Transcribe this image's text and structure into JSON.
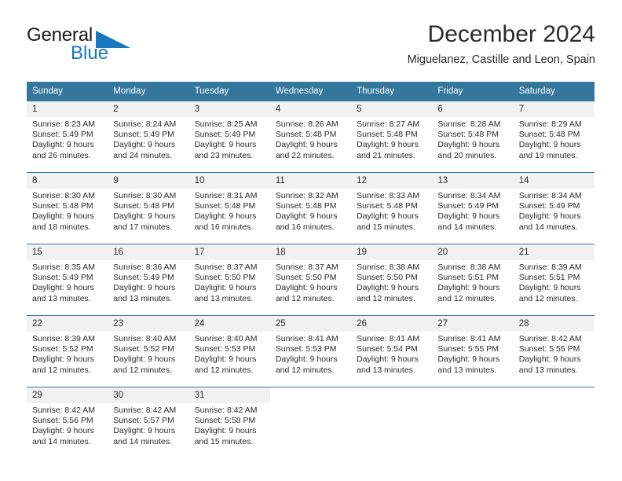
{
  "logo": {
    "primary_text": "General",
    "secondary_text": "Blue",
    "triangle_icon": "blue-triangle-icon",
    "primary_color": "#1a1a1a",
    "secondary_color": "#1878be"
  },
  "header": {
    "title": "December 2024",
    "subtitle": "Miguelanez, Castille and Leon, Spain"
  },
  "theme": {
    "header_blue": "#34769c",
    "daynum_bg": "#f1f1f1",
    "text_color": "#2b2b2b"
  },
  "weekday_headers": [
    "Sunday",
    "Monday",
    "Tuesday",
    "Wednesday",
    "Thursday",
    "Friday",
    "Saturday"
  ],
  "weeks": [
    [
      {
        "day": "1",
        "sunrise": "Sunrise: 8:23 AM",
        "sunset": "Sunset: 5:49 PM",
        "daylight_1": "Daylight: 9 hours",
        "daylight_2": "and 26 minutes."
      },
      {
        "day": "2",
        "sunrise": "Sunrise: 8:24 AM",
        "sunset": "Sunset: 5:49 PM",
        "daylight_1": "Daylight: 9 hours",
        "daylight_2": "and 24 minutes."
      },
      {
        "day": "3",
        "sunrise": "Sunrise: 8:25 AM",
        "sunset": "Sunset: 5:49 PM",
        "daylight_1": "Daylight: 9 hours",
        "daylight_2": "and 23 minutes."
      },
      {
        "day": "4",
        "sunrise": "Sunrise: 8:26 AM",
        "sunset": "Sunset: 5:48 PM",
        "daylight_1": "Daylight: 9 hours",
        "daylight_2": "and 22 minutes."
      },
      {
        "day": "5",
        "sunrise": "Sunrise: 8:27 AM",
        "sunset": "Sunset: 5:48 PM",
        "daylight_1": "Daylight: 9 hours",
        "daylight_2": "and 21 minutes."
      },
      {
        "day": "6",
        "sunrise": "Sunrise: 8:28 AM",
        "sunset": "Sunset: 5:48 PM",
        "daylight_1": "Daylight: 9 hours",
        "daylight_2": "and 20 minutes."
      },
      {
        "day": "7",
        "sunrise": "Sunrise: 8:29 AM",
        "sunset": "Sunset: 5:48 PM",
        "daylight_1": "Daylight: 9 hours",
        "daylight_2": "and 19 minutes."
      }
    ],
    [
      {
        "day": "8",
        "sunrise": "Sunrise: 8:30 AM",
        "sunset": "Sunset: 5:48 PM",
        "daylight_1": "Daylight: 9 hours",
        "daylight_2": "and 18 minutes."
      },
      {
        "day": "9",
        "sunrise": "Sunrise: 8:30 AM",
        "sunset": "Sunset: 5:48 PM",
        "daylight_1": "Daylight: 9 hours",
        "daylight_2": "and 17 minutes."
      },
      {
        "day": "10",
        "sunrise": "Sunrise: 8:31 AM",
        "sunset": "Sunset: 5:48 PM",
        "daylight_1": "Daylight: 9 hours",
        "daylight_2": "and 16 minutes."
      },
      {
        "day": "11",
        "sunrise": "Sunrise: 8:32 AM",
        "sunset": "Sunset: 5:48 PM",
        "daylight_1": "Daylight: 9 hours",
        "daylight_2": "and 16 minutes."
      },
      {
        "day": "12",
        "sunrise": "Sunrise: 8:33 AM",
        "sunset": "Sunset: 5:48 PM",
        "daylight_1": "Daylight: 9 hours",
        "daylight_2": "and 15 minutes."
      },
      {
        "day": "13",
        "sunrise": "Sunrise: 8:34 AM",
        "sunset": "Sunset: 5:49 PM",
        "daylight_1": "Daylight: 9 hours",
        "daylight_2": "and 14 minutes."
      },
      {
        "day": "14",
        "sunrise": "Sunrise: 8:34 AM",
        "sunset": "Sunset: 5:49 PM",
        "daylight_1": "Daylight: 9 hours",
        "daylight_2": "and 14 minutes."
      }
    ],
    [
      {
        "day": "15",
        "sunrise": "Sunrise: 8:35 AM",
        "sunset": "Sunset: 5:49 PM",
        "daylight_1": "Daylight: 9 hours",
        "daylight_2": "and 13 minutes."
      },
      {
        "day": "16",
        "sunrise": "Sunrise: 8:36 AM",
        "sunset": "Sunset: 5:49 PM",
        "daylight_1": "Daylight: 9 hours",
        "daylight_2": "and 13 minutes."
      },
      {
        "day": "17",
        "sunrise": "Sunrise: 8:37 AM",
        "sunset": "Sunset: 5:50 PM",
        "daylight_1": "Daylight: 9 hours",
        "daylight_2": "and 13 minutes."
      },
      {
        "day": "18",
        "sunrise": "Sunrise: 8:37 AM",
        "sunset": "Sunset: 5:50 PM",
        "daylight_1": "Daylight: 9 hours",
        "daylight_2": "and 12 minutes."
      },
      {
        "day": "19",
        "sunrise": "Sunrise: 8:38 AM",
        "sunset": "Sunset: 5:50 PM",
        "daylight_1": "Daylight: 9 hours",
        "daylight_2": "and 12 minutes."
      },
      {
        "day": "20",
        "sunrise": "Sunrise: 8:38 AM",
        "sunset": "Sunset: 5:51 PM",
        "daylight_1": "Daylight: 9 hours",
        "daylight_2": "and 12 minutes."
      },
      {
        "day": "21",
        "sunrise": "Sunrise: 8:39 AM",
        "sunset": "Sunset: 5:51 PM",
        "daylight_1": "Daylight: 9 hours",
        "daylight_2": "and 12 minutes."
      }
    ],
    [
      {
        "day": "22",
        "sunrise": "Sunrise: 8:39 AM",
        "sunset": "Sunset: 5:52 PM",
        "daylight_1": "Daylight: 9 hours",
        "daylight_2": "and 12 minutes."
      },
      {
        "day": "23",
        "sunrise": "Sunrise: 8:40 AM",
        "sunset": "Sunset: 5:52 PM",
        "daylight_1": "Daylight: 9 hours",
        "daylight_2": "and 12 minutes."
      },
      {
        "day": "24",
        "sunrise": "Sunrise: 8:40 AM",
        "sunset": "Sunset: 5:53 PM",
        "daylight_1": "Daylight: 9 hours",
        "daylight_2": "and 12 minutes."
      },
      {
        "day": "25",
        "sunrise": "Sunrise: 8:41 AM",
        "sunset": "Sunset: 5:53 PM",
        "daylight_1": "Daylight: 9 hours",
        "daylight_2": "and 12 minutes."
      },
      {
        "day": "26",
        "sunrise": "Sunrise: 8:41 AM",
        "sunset": "Sunset: 5:54 PM",
        "daylight_1": "Daylight: 9 hours",
        "daylight_2": "and 13 minutes."
      },
      {
        "day": "27",
        "sunrise": "Sunrise: 8:41 AM",
        "sunset": "Sunset: 5:55 PM",
        "daylight_1": "Daylight: 9 hours",
        "daylight_2": "and 13 minutes."
      },
      {
        "day": "28",
        "sunrise": "Sunrise: 8:42 AM",
        "sunset": "Sunset: 5:55 PM",
        "daylight_1": "Daylight: 9 hours",
        "daylight_2": "and 13 minutes."
      }
    ],
    [
      {
        "day": "29",
        "sunrise": "Sunrise: 8:42 AM",
        "sunset": "Sunset: 5:56 PM",
        "daylight_1": "Daylight: 9 hours",
        "daylight_2": "and 14 minutes."
      },
      {
        "day": "30",
        "sunrise": "Sunrise: 8:42 AM",
        "sunset": "Sunset: 5:57 PM",
        "daylight_1": "Daylight: 9 hours",
        "daylight_2": "and 14 minutes."
      },
      {
        "day": "31",
        "sunrise": "Sunrise: 8:42 AM",
        "sunset": "Sunset: 5:58 PM",
        "daylight_1": "Daylight: 9 hours",
        "daylight_2": "and 15 minutes."
      },
      null,
      null,
      null,
      null
    ]
  ]
}
